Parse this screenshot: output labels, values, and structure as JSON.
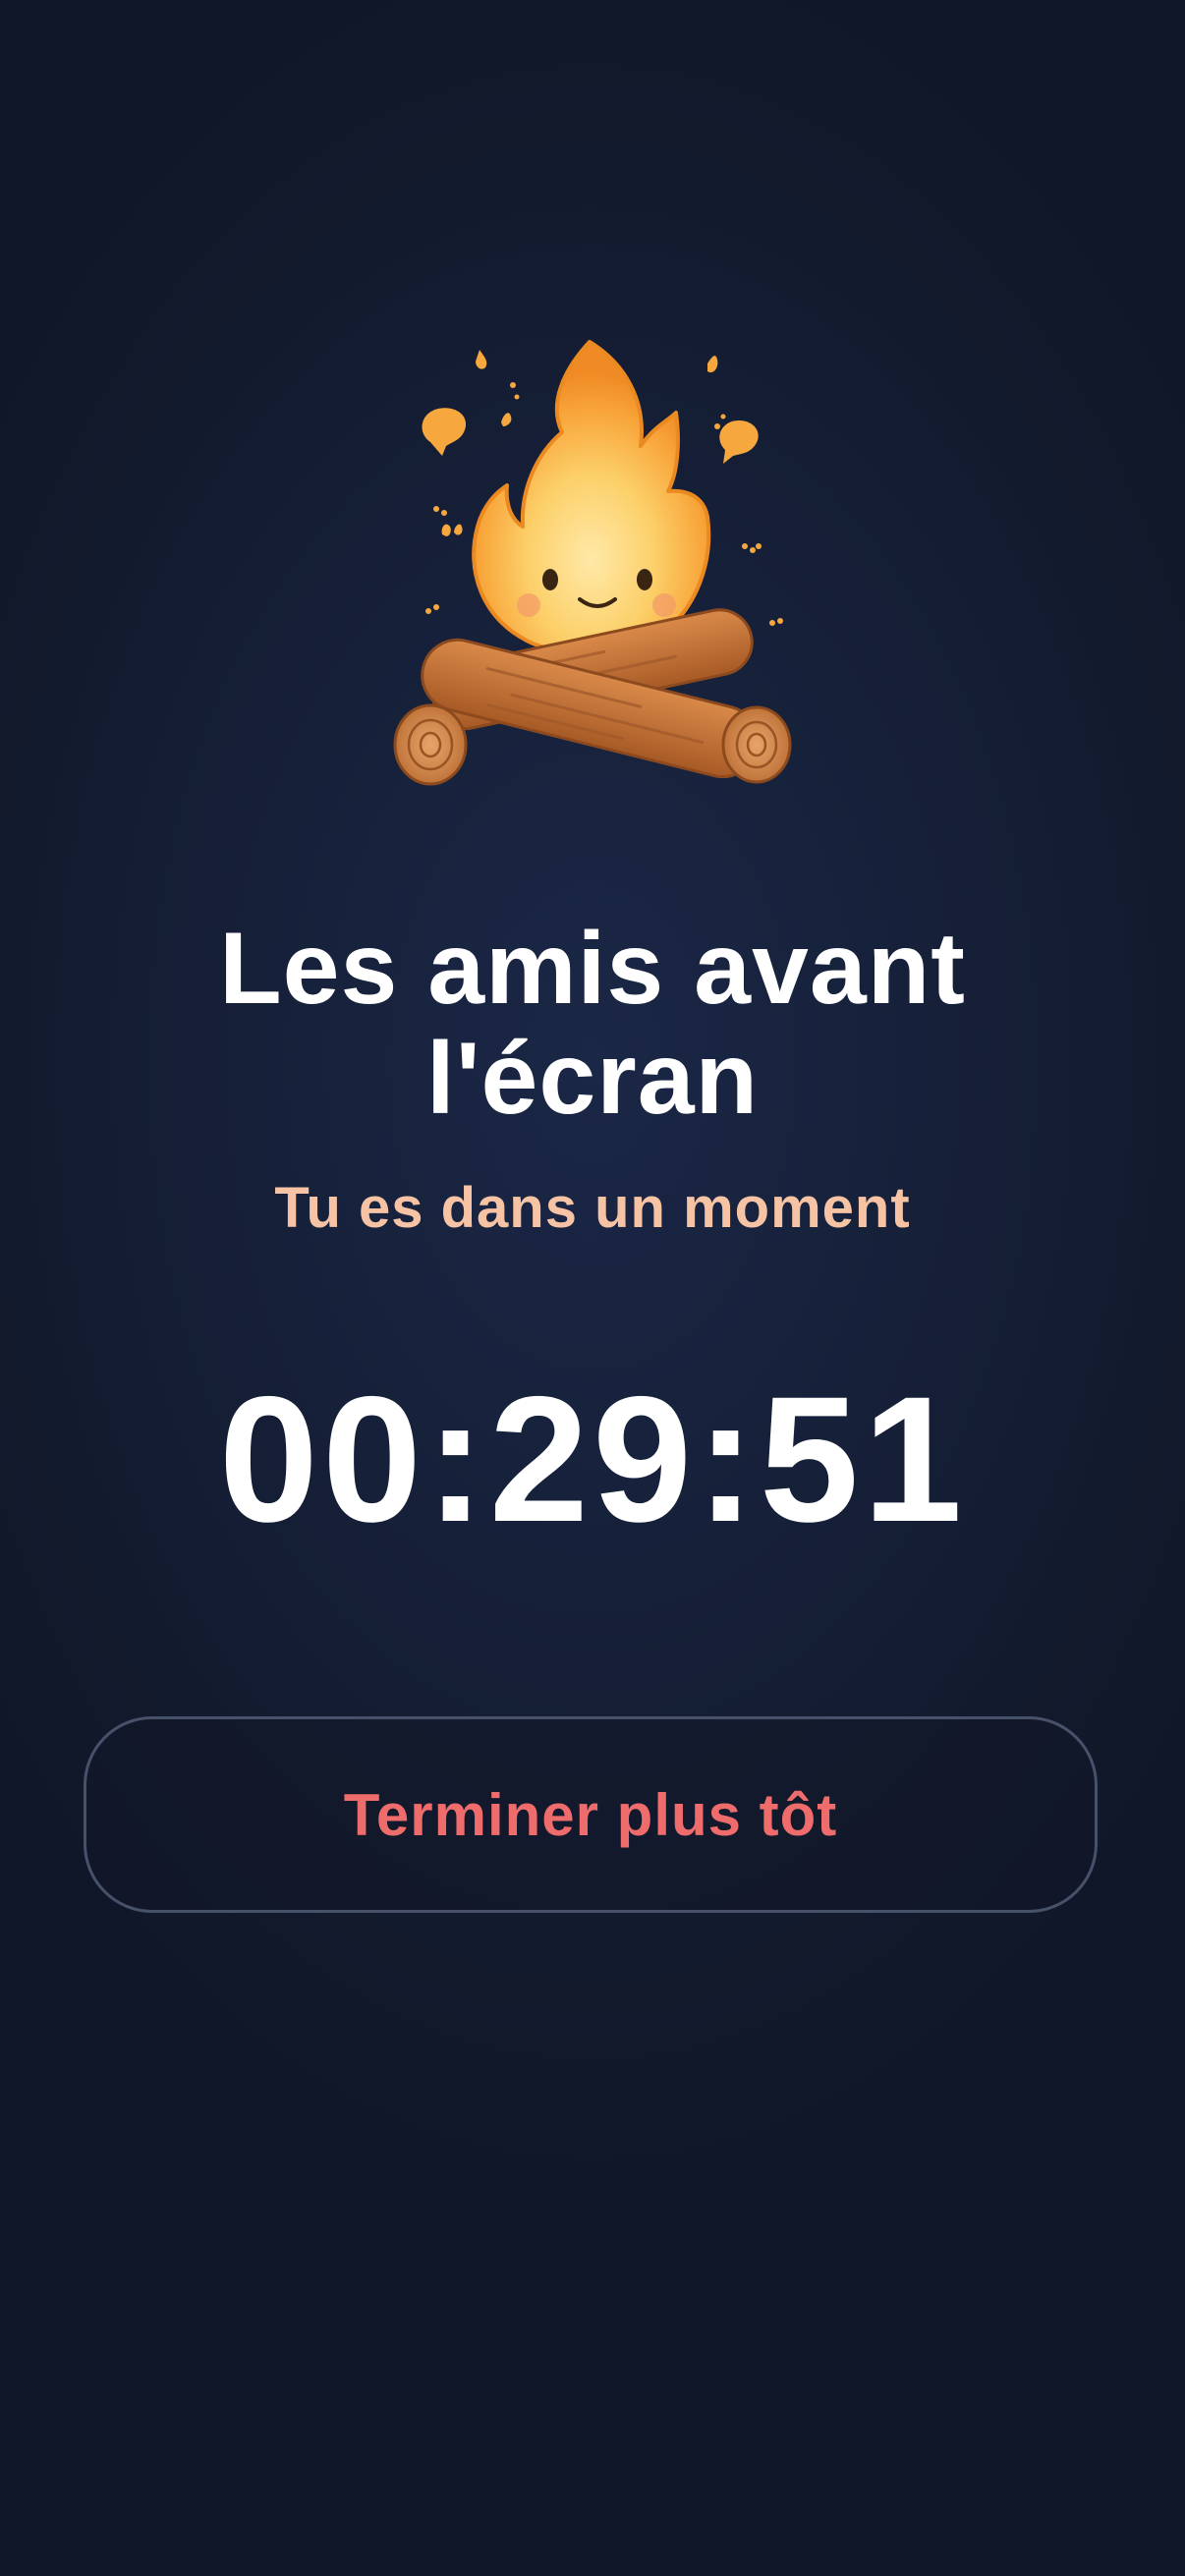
{
  "screen": {
    "illustration": "campfire-mascot",
    "title_line1": "Les amis avant",
    "title_line2": "l'écran",
    "subtitle": "Tu es dans un moment",
    "timer": "00:29:51",
    "end_button_label": "Terminer plus tôt"
  },
  "colors": {
    "background": "#141c30",
    "title": "#ffffff",
    "subtitle": "#f6c4a4",
    "end_button_text": "#ee6c6c",
    "end_button_border": "#48516a",
    "flame": "#f9a23a",
    "log": "#c7743a"
  }
}
